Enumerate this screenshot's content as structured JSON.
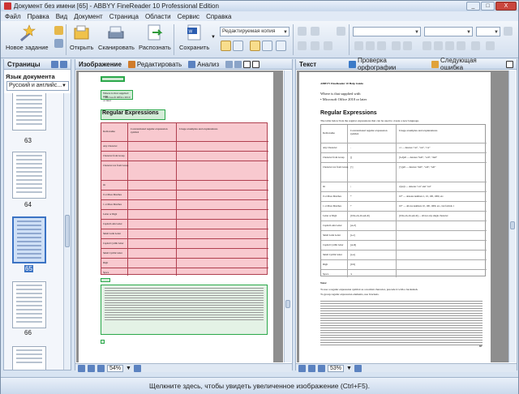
{
  "window": {
    "title": "Документ без имени [65] - ABBYY FineReader 10 Professional Edition",
    "controls": [
      "_",
      "□",
      "X"
    ]
  },
  "menu": [
    "Файл",
    "Правка",
    "Вид",
    "Документ",
    "Страница",
    "Области",
    "Сервис",
    "Справка"
  ],
  "toolbar": {
    "new_task": "Новое задание",
    "open": "Открыть",
    "scan": "Сканировать",
    "recognize": "Распознать",
    "save": "Сохранить",
    "save_mode": "Редактируемая копия"
  },
  "pages_panel": {
    "title": "Страницы",
    "language_label": "Язык документа",
    "language_value": "Русский и английс...",
    "page_numbers": [
      "63",
      "64",
      "65",
      "66"
    ],
    "selected_page": "65"
  },
  "image_panel": {
    "title": "Изображение",
    "edit": "Редактировать",
    "analyze": "Анализ",
    "zoom": "54%"
  },
  "text_panel": {
    "title": "Текст",
    "spellcheck": "Проверка орфографии",
    "next_error": "Следующая ошибка",
    "zoom": "53%"
  },
  "document": {
    "heading": "Regular Expressions",
    "header_line": "ABBYY FineReader 10 Help Guide",
    "intro1": "Where is that supplied with",
    "intro2": "• Microsoft Office 2010 or later",
    "subtitle": "The table below lists the regular expressions that can be used to create a new language.",
    "col_headers": [
      "Item name",
      "Conventional regular expression symbol",
      "Usage examples and explanations"
    ],
    "rows": [
      [
        "Any Character",
        ".",
        "c.t — denotes \"cat\", \"cut\", \"cot\""
      ],
      [
        "Character from Group",
        "[]",
        "[b-d]ell — denotes \"bell\", \"cell\", \"dell\""
      ],
      [
        "Character not from Group",
        "[^]",
        "[^y]ell — denotes \"dell\", \"cell\", \"tell\""
      ],
      [
        "Or",
        "|",
        "c(a|u)t — denotes \"cat\" and \"cut\""
      ],
      [
        "0 or More Matches",
        "*",
        "10* — denotes numbers 1, 10, 100, 1000, etc."
      ],
      [
        "1 or More Matches",
        "+",
        "10+ — allows numbers 10, 100, 1000, etc., but forbids 1"
      ],
      [
        "Letter or Digit",
        "[0-9a-zA-Zа-яА-Я]",
        "[0-9a-zA-Zа-яА-Я] — allows any single character"
      ],
      [
        "Capital Latin Letter",
        "[A-Z]",
        ""
      ],
      [
        "Small Latin Letter",
        "[a-z]",
        ""
      ],
      [
        "Capital Cyrillic letter",
        "[А-Я]",
        ""
      ],
      [
        "Small Cyrillic letter",
        "[а-я]",
        ""
      ],
      [
        "Digit",
        "[0-9]",
        ""
      ],
      [
        "Space",
        "\\s",
        ""
      ],
      [
        "",
        "@",
        "Reserved."
      ]
    ],
    "note_label": "Note:",
    "note1": "To use a regular expression symbol as a normal character, precede it with a backslash.",
    "note2": "To group regular expression elements, use brackets.",
    "page_number": "87"
  },
  "statusbar": "Щелкните здесь, чтобы увидеть увеличенное изображение (Ctrl+F5).",
  "colors": {
    "table_fill": "#f8c9cf",
    "table_border": "#b04050",
    "selection": "#3b73c4"
  }
}
